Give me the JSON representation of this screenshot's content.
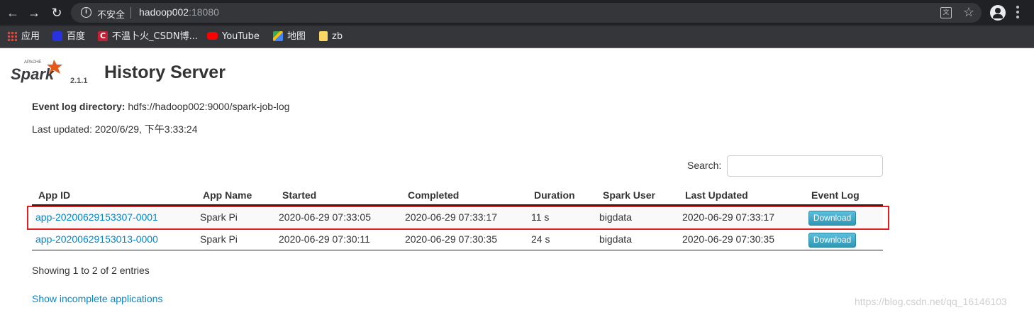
{
  "browser": {
    "insecure_label": "不安全",
    "url_host": "hadoop002",
    "url_port": ":18080",
    "bookmarks": [
      {
        "label": "应用",
        "icon": "apps-icon"
      },
      {
        "label": "百度",
        "icon": "baidu-icon"
      },
      {
        "label": "不温卜火_CSDN博...",
        "icon": "csdn-icon",
        "glyph": "C"
      },
      {
        "label": "YouTube",
        "icon": "youtube-icon"
      },
      {
        "label": "地图",
        "icon": "maps-icon"
      },
      {
        "label": "zb",
        "icon": "folder-icon"
      }
    ]
  },
  "header": {
    "logo_text": "Spark",
    "logo_apache": "APACHE",
    "version": "2.1.1",
    "title": "History Server"
  },
  "info": {
    "event_log_label": "Event log directory:",
    "event_log_value": "hdfs://hadoop002:9000/spark-job-log",
    "last_updated": "Last updated: 2020/6/29, 下午3:33:24"
  },
  "search": {
    "label": "Search:",
    "value": ""
  },
  "table": {
    "columns": [
      "App ID",
      "App Name",
      "Started",
      "Completed",
      "Duration",
      "Spark User",
      "Last Updated",
      "Event Log"
    ],
    "rows": [
      {
        "app_id": "app-20200629153307-0001",
        "app_name": "Spark Pi",
        "started": "2020-06-29 07:33:05",
        "completed": "2020-06-29 07:33:17",
        "duration": "11 s",
        "user": "bigdata",
        "last_updated": "2020-06-29 07:33:17",
        "event_log": "Download"
      },
      {
        "app_id": "app-20200629153013-0000",
        "app_name": "Spark Pi",
        "started": "2020-06-29 07:30:11",
        "completed": "2020-06-29 07:30:35",
        "duration": "24 s",
        "user": "bigdata",
        "last_updated": "2020-06-29 07:30:35",
        "event_log": "Download"
      }
    ]
  },
  "footer": {
    "showing": "Showing 1 to 2 of 2 entries",
    "incomplete_link": "Show incomplete applications",
    "watermark": "https://blog.csdn.net/qq_16146103"
  },
  "colors": {
    "link": "#0088cc",
    "highlight": "#e0201e",
    "download_button": "#49afcd"
  }
}
